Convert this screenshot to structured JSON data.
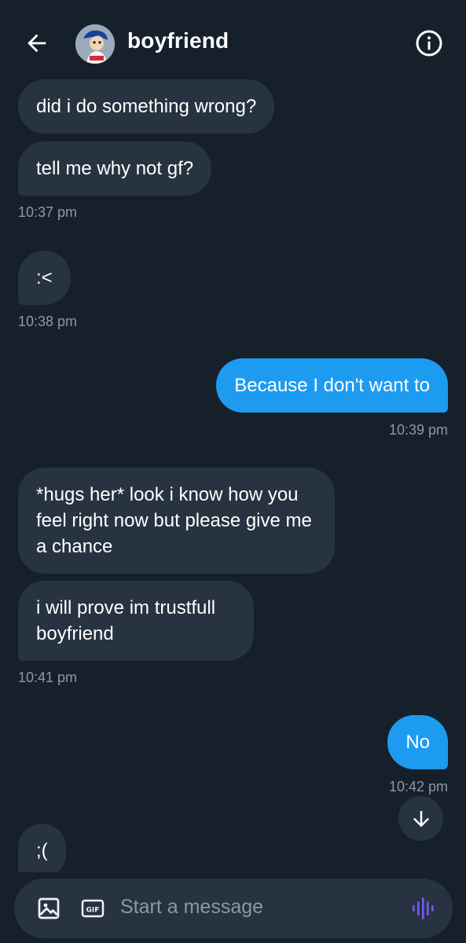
{
  "header": {
    "title": "boyfriend"
  },
  "messages": [
    {
      "direction": "in",
      "text": "did i do something wrong?"
    },
    {
      "direction": "in",
      "text": "tell me why not gf?"
    },
    {
      "timestamp": "10:37 pm"
    },
    {
      "direction": "in",
      "text": ":<"
    },
    {
      "timestamp": "10:38 pm"
    },
    {
      "direction": "out",
      "text": "Because I don't want to"
    },
    {
      "timestamp": "10:39 pm"
    },
    {
      "direction": "in",
      "text": "*hugs her* look i know how you feel right now but please give me a chance"
    },
    {
      "direction": "in",
      "text": "i will prove im trustfull boyfriend"
    },
    {
      "timestamp": "10:41 pm"
    },
    {
      "direction": "out",
      "text": "No"
    },
    {
      "timestamp": "10:42 pm"
    },
    {
      "direction": "in",
      "text": ";("
    }
  ],
  "composer": {
    "placeholder": "Start a message",
    "gif_label": "GIF"
  },
  "colors": {
    "background": "#15202b",
    "incoming_bubble": "#273340",
    "outgoing_bubble": "#1d9bf0",
    "timestamp": "#8b98a5",
    "voice_accent": "#7856ff"
  },
  "icons": [
    "back-arrow-icon",
    "avatar",
    "info-icon",
    "arrow-down-icon",
    "image-icon",
    "gif-icon",
    "voice-icon"
  ]
}
